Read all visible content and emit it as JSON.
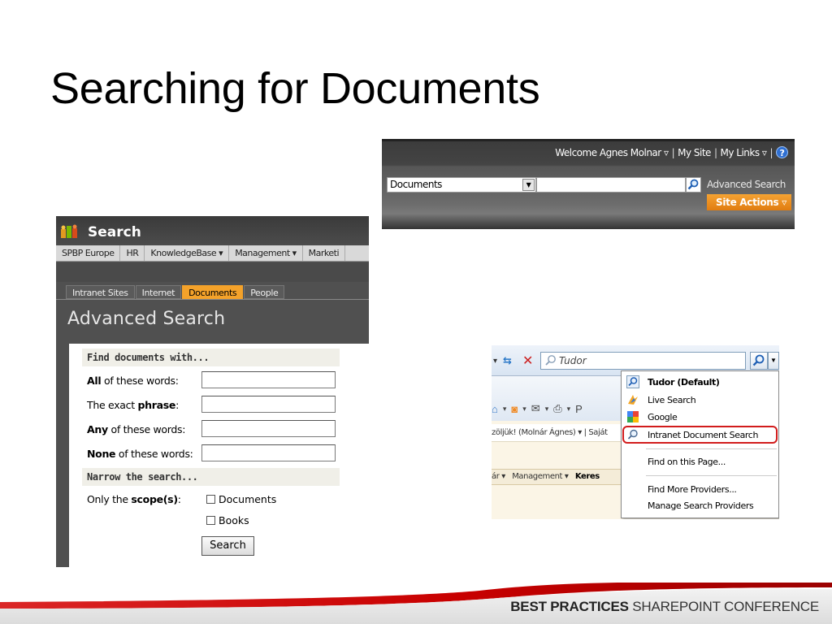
{
  "slide": {
    "title": "Searching for Documents"
  },
  "topbar": {
    "welcome": "Welcome Agnes Molnar",
    "my_site": "My Site",
    "my_links": "My Links",
    "scope_value": "Documents",
    "advanced_search": "Advanced Search",
    "site_actions": "Site Actions",
    "help_icon": "help-icon"
  },
  "advanced": {
    "app_title": "Search",
    "nav": [
      "SPBP Europe",
      "HR",
      "KnowledgeBase ▾",
      "Management ▾",
      "Marketi"
    ],
    "tabs": [
      "Intranet Sites",
      "Internet",
      "Documents",
      "People"
    ],
    "active_tab": "Documents",
    "heading": "Advanced Search",
    "section1": "Find documents with...",
    "fields": [
      {
        "bold": "All",
        "rest": " of these words:"
      },
      {
        "pre": "The exact ",
        "bold": "phrase",
        "rest": ":"
      },
      {
        "bold": "Any",
        "rest": " of these words:"
      },
      {
        "bold": "None",
        "rest": " of these words:"
      }
    ],
    "section2": "Narrow the search...",
    "scope_label_pre": "Only the ",
    "scope_label_bold": "scope(s)",
    "scope_label_post": ":",
    "scopes": [
      "Documents",
      "Books"
    ],
    "search_button": "Search"
  },
  "browser": {
    "search_text": "Tudor",
    "providers": [
      {
        "label": "Tudor (Default)",
        "icon": "magnifier-icon",
        "bold": true
      },
      {
        "label": "Live Search",
        "icon": "live-search-icon",
        "bold": false
      },
      {
        "label": "Google",
        "icon": "google-icon",
        "bold": false
      },
      {
        "label": "Intranet Document Search",
        "icon": "magnifier-icon",
        "bold": false,
        "highlighted": true
      }
    ],
    "find_on_page": "Find on this Page...",
    "find_more": "Find More Providers...",
    "manage": "Manage Search Providers",
    "welcome_fragment": "zöljük! (Molnár Ágnes) ▾  |  Saját",
    "nav_fragment_1": "ár ▾",
    "nav_fragment_2": "Management ▾",
    "nav_fragment_3": "Keres",
    "toolbar_letter": "P",
    "highlight_color": "#d21c1c"
  },
  "footer": {
    "brand_bold": "BEST PRACTICES",
    "brand_rest": " SHAREPOINT CONFERENCE",
    "accent": "#cc0000"
  }
}
